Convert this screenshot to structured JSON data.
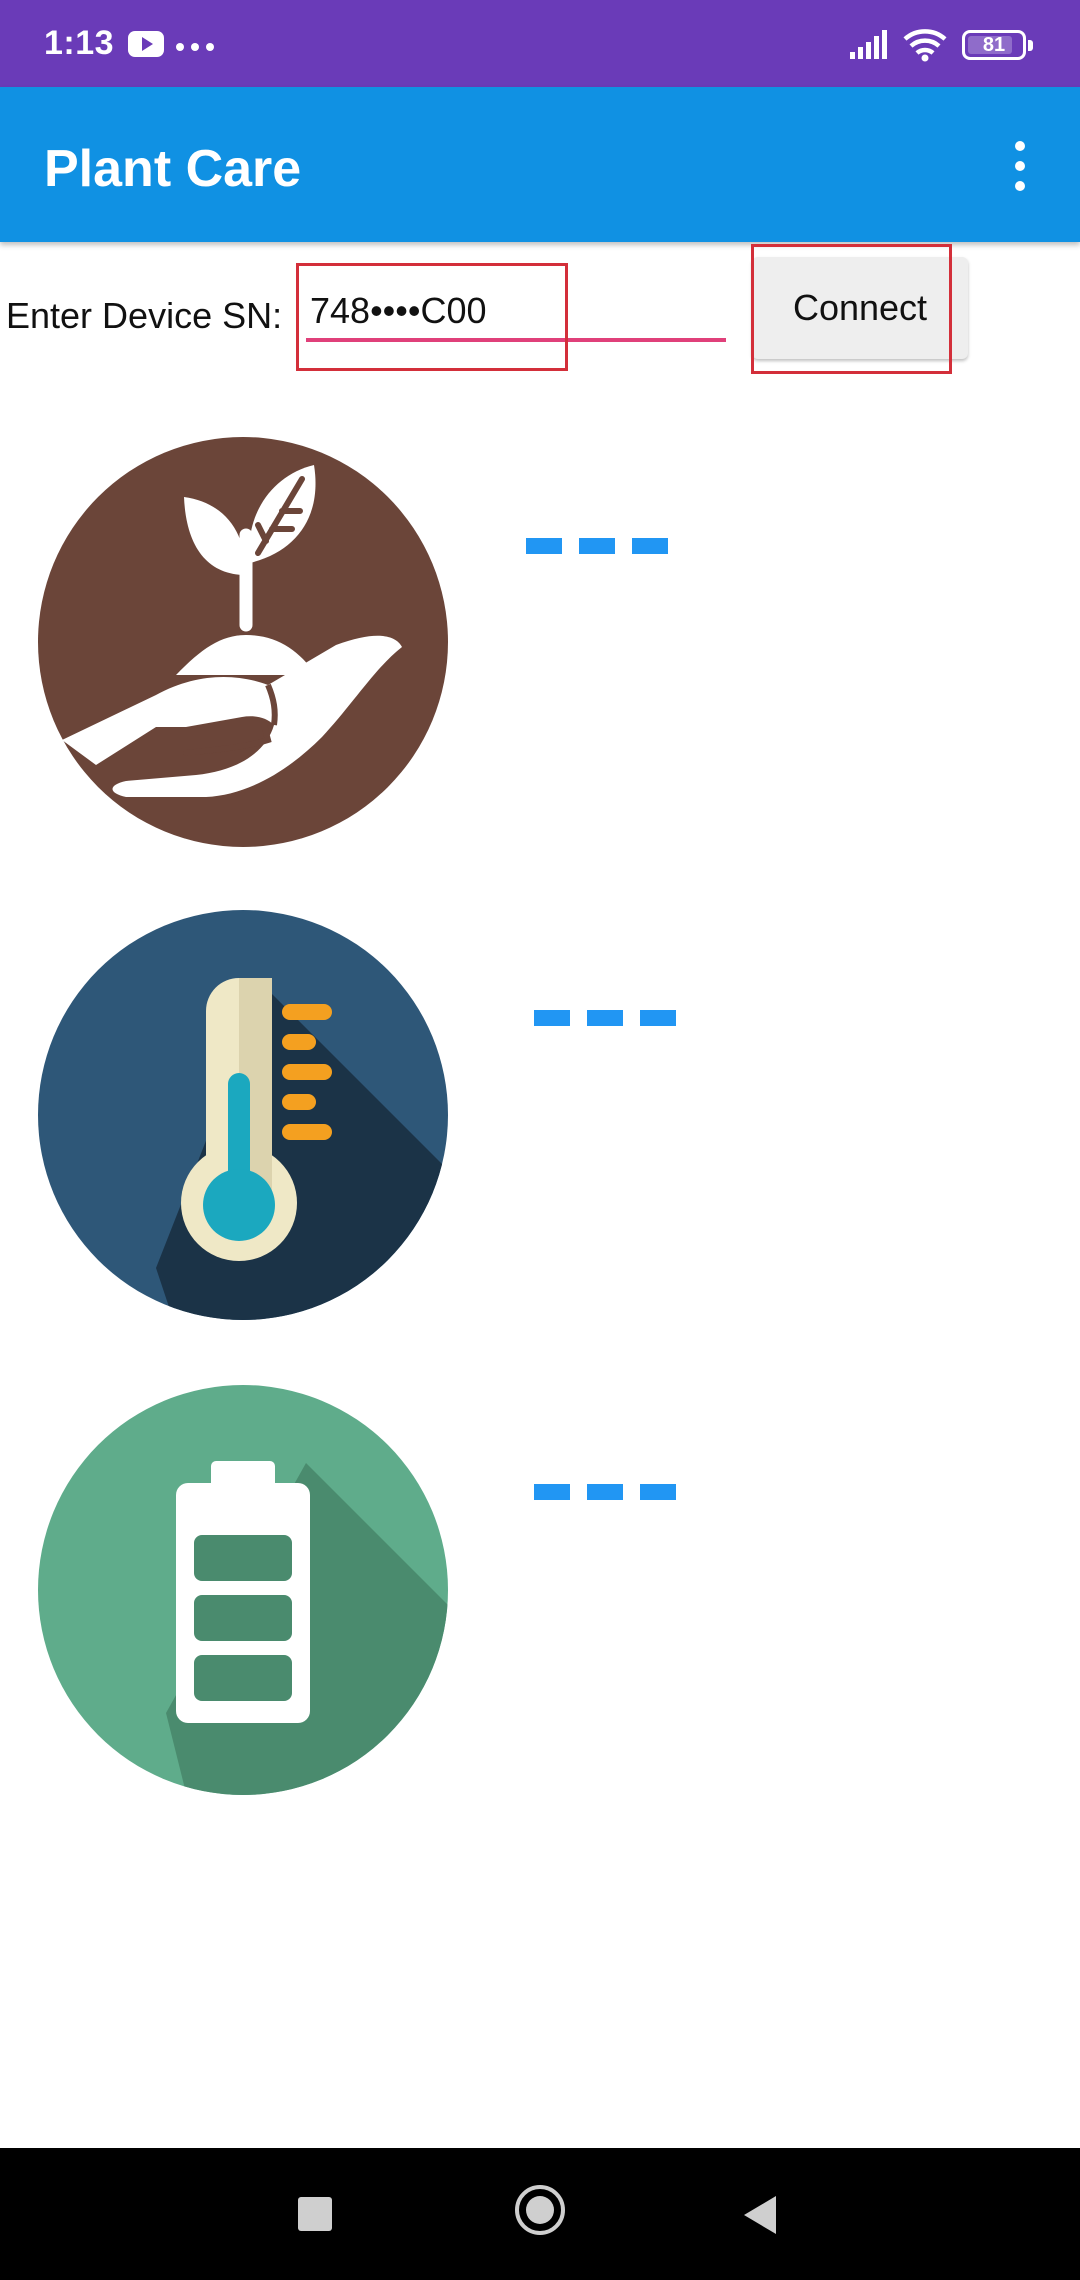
{
  "status_bar": {
    "time": "1:13",
    "battery_level": "81"
  },
  "app_bar": {
    "title": "Plant Care"
  },
  "device": {
    "label": "Enter Device SN:",
    "sn_value": "748••••C00",
    "connect_label": "Connect"
  },
  "sensors": [
    {
      "icon": "plant-in-hand-icon",
      "value": "---",
      "color": "#6b4539"
    },
    {
      "icon": "thermometer-icon",
      "value": "---",
      "color": "#2e5778"
    },
    {
      "icon": "battery-icon",
      "value": "---",
      "color": "#5fac8b"
    }
  ],
  "colors": {
    "status_bar": "#6a3bb8",
    "app_bar": "#1091e3",
    "accent": "#e0407a",
    "value": "#2196f3",
    "highlight": "#d32f3a"
  }
}
